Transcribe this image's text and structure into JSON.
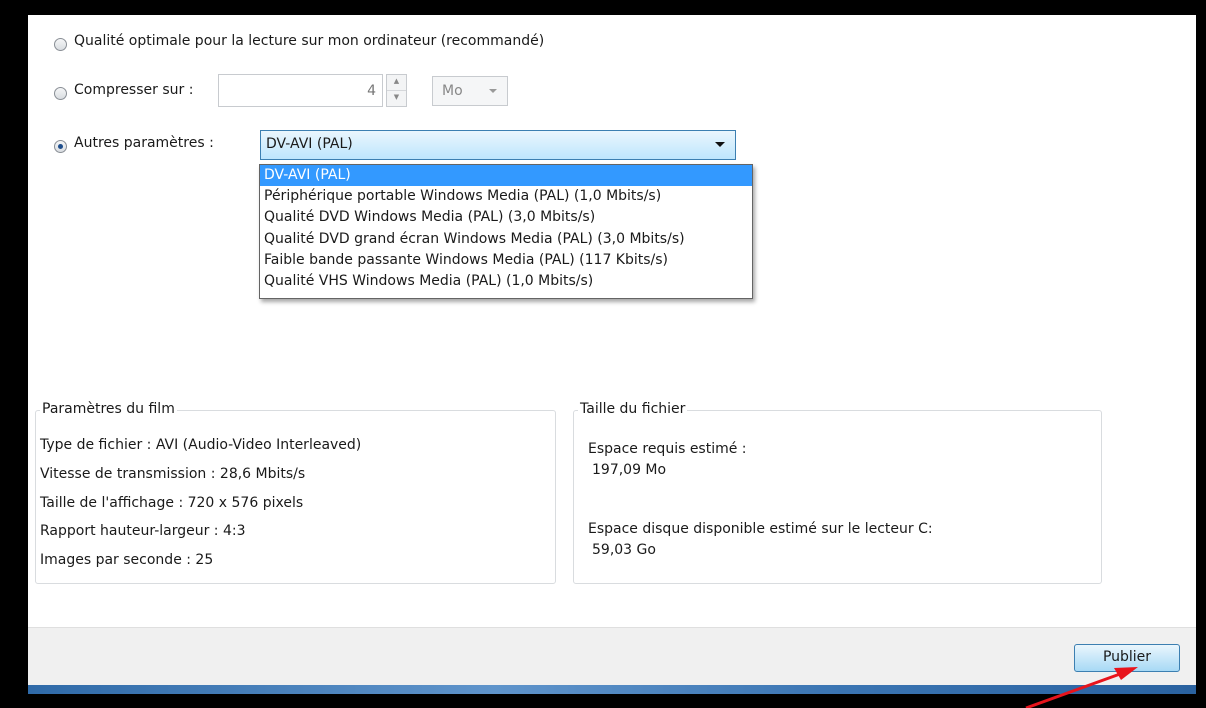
{
  "export_options": {
    "option_optimal": {
      "label": "Qualité optimale pour la lecture sur mon ordinateur (recommandé)",
      "selected": false
    },
    "option_compress": {
      "label": "Compresser sur :",
      "value": "4",
      "unit": "Mo",
      "selected": false
    },
    "option_other": {
      "label": "Autres paramètres :",
      "selected_value": "DV-AVI (PAL)",
      "selected": true
    }
  },
  "dropdown": {
    "items": [
      "DV-AVI (PAL)",
      "Périphérique portable Windows Media (PAL) (1,0 Mbits/s)",
      "Qualité DVD Windows Media (PAL) (3,0 Mbits/s)",
      "Qualité DVD grand écran Windows Media (PAL) (3,0 Mbits/s)",
      "Faible bande passante Windows Media (PAL) (117 Kbits/s)",
      "Qualité VHS Windows Media (PAL) (1,0 Mbits/s)"
    ],
    "highlighted_index": 0
  },
  "movie_settings": {
    "title": "Paramètres du film",
    "lines": [
      "Type de fichier : AVI (Audio-Video Interleaved)",
      "Vitesse de transmission : 28,6 Mbits/s",
      "Taille de l'affichage : 720 x 576 pixels",
      "Rapport hauteur-largeur : 4:3",
      "Images par seconde : 25"
    ]
  },
  "file_size": {
    "title": "Taille du fichier",
    "required_label": "Espace requis estimé :",
    "required_value": "197,09 Mo",
    "available_label": "Espace disque disponible estimé sur le lecteur C:",
    "available_value": "59,03 Go"
  },
  "footer": {
    "publish_label": "Publier"
  },
  "annotation": {
    "arrow_color": "#e8141c"
  }
}
